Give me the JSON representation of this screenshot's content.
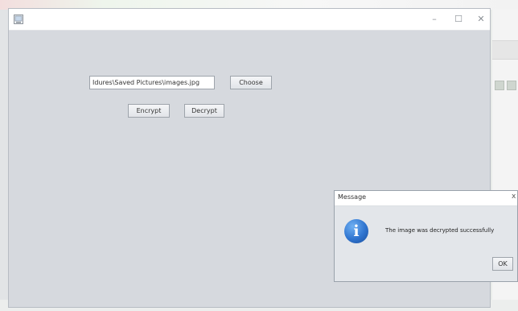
{
  "main_window": {
    "title": "",
    "controls": {
      "minimize": "–",
      "maximize": "☐",
      "close": "✕"
    },
    "file_path": "Idures\\Saved Pictures\\images.jpg",
    "choose_label": "Choose",
    "encrypt_label": "Encrypt",
    "decrypt_label": "Decrypt"
  },
  "dialog": {
    "title": "Message",
    "close": "x",
    "icon": "info-icon",
    "icon_glyph": "i",
    "message": "The image was decrypted successfully",
    "ok_label": "OK"
  }
}
